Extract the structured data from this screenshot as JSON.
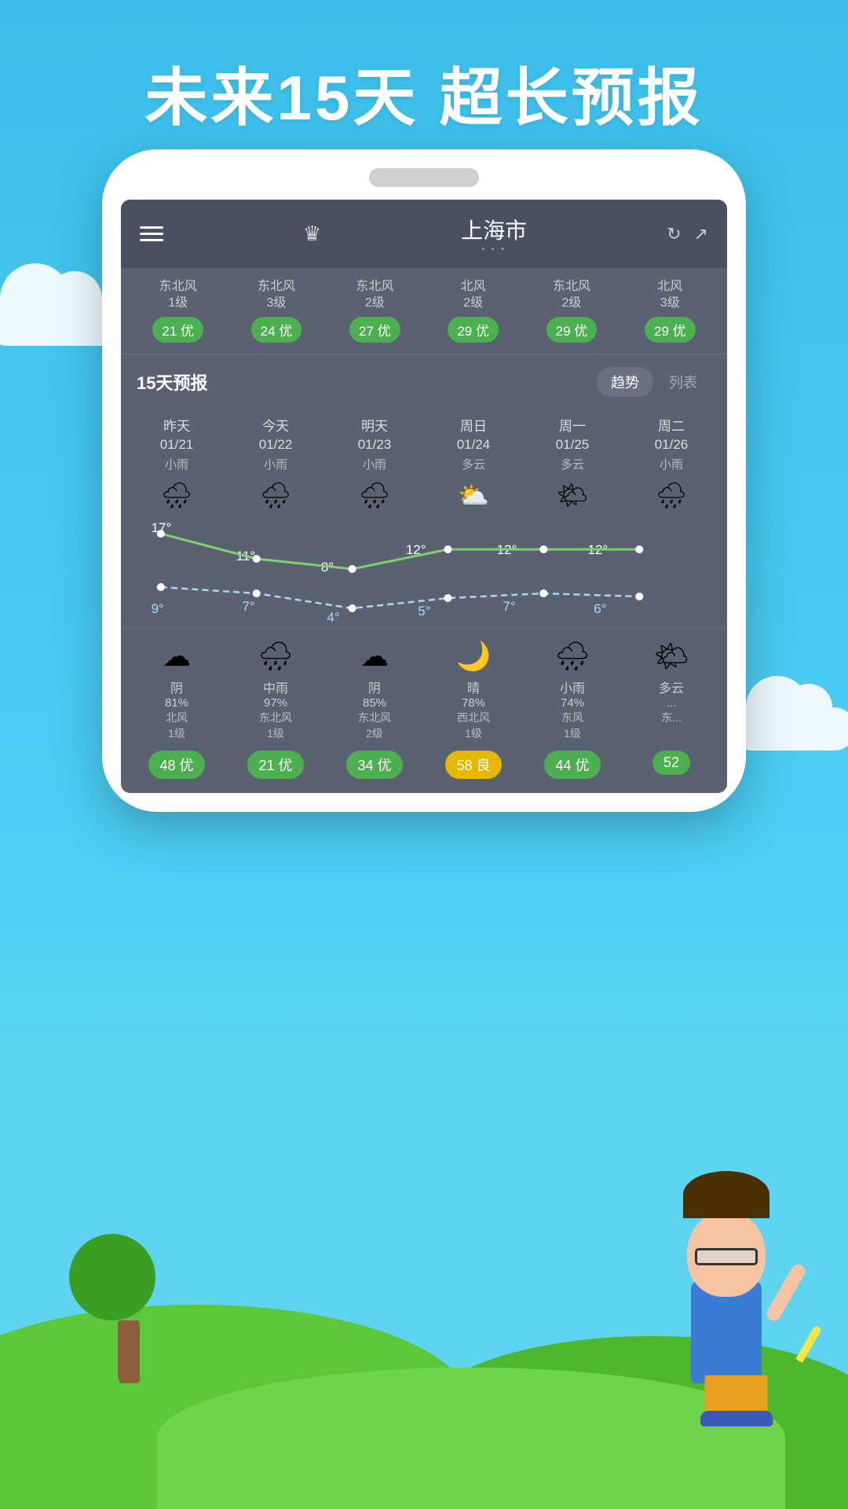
{
  "headline": "未来15天  超长预报",
  "header": {
    "city": "上海市",
    "city_dots": "· · ·"
  },
  "aqi_top": {
    "items": [
      {
        "wind": "东北风\n1级",
        "badge": "21 优"
      },
      {
        "wind": "东北风\n3级",
        "badge": "24 优"
      },
      {
        "wind": "东北风\n2级",
        "badge": "27 优"
      },
      {
        "wind": "北风\n2级",
        "badge": "29 优"
      },
      {
        "wind": "东北风\n2级",
        "badge": "29 优"
      },
      {
        "wind": "北风\n3级",
        "badge": "29 优"
      }
    ]
  },
  "forecast": {
    "title": "15天预报",
    "tab_trend": "趋势",
    "tab_list": "列表",
    "days": [
      {
        "label": "昨天\n01/21",
        "condition": "小雨",
        "icon": "🌧",
        "high": "17°",
        "low": "9°"
      },
      {
        "label": "今天\n01/22",
        "condition": "小雨",
        "icon": "🌧",
        "high": "11°",
        "low": "7°"
      },
      {
        "label": "明天\n01/23",
        "condition": "小雨",
        "icon": "🌧",
        "high": "8°",
        "low": "4°"
      },
      {
        "label": "周日\n01/24",
        "condition": "多云",
        "icon": "⛅",
        "high": "12°",
        "low": "5°"
      },
      {
        "label": "周一\n01/25",
        "condition": "多云",
        "icon": "🌤",
        "high": "12°",
        "low": "7°"
      },
      {
        "label": "周二\n01/26",
        "condition": "小雨",
        "icon": "🌧",
        "high": "12°",
        "low": "6°"
      }
    ]
  },
  "bottom_days": [
    {
      "icon": "☁",
      "condition": "阴",
      "percent": "81%",
      "wind": "北风\n1级",
      "badge": "48 优",
      "badge_color": "green"
    },
    {
      "icon": "🌧",
      "condition": "中雨",
      "percent": "97%",
      "wind": "东北风\n1级",
      "badge": "21 优",
      "badge_color": "green"
    },
    {
      "icon": "☁",
      "condition": "阴",
      "percent": "85%",
      "wind": "东北风\n2级",
      "badge": "34 优",
      "badge_color": "green"
    },
    {
      "icon": "🌙",
      "condition": "晴",
      "percent": "78%",
      "wind": "西北风\n1级",
      "badge": "58 良",
      "badge_color": "yellow"
    },
    {
      "icon": "🌧",
      "condition": "小雨",
      "percent": "74%",
      "wind": "东风\n1级",
      "badge": "44 优",
      "badge_color": "green"
    },
    {
      "icon": "☁",
      "condition": "多云",
      "percent": "...",
      "wind": "东...",
      "badge": "52",
      "badge_color": "green"
    }
  ]
}
